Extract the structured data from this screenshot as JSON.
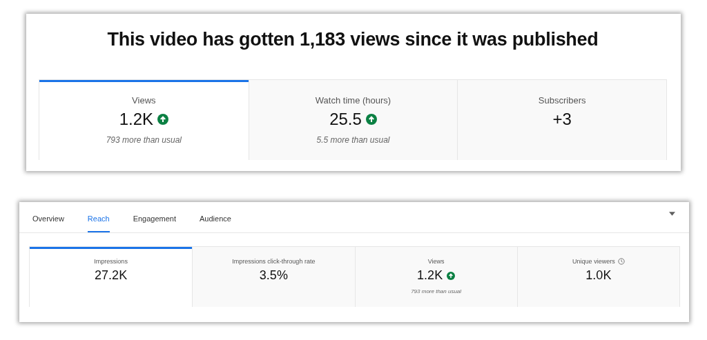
{
  "summary": {
    "heading": "This video has gotten 1,183 views since it was published",
    "metrics": [
      {
        "label": "Views",
        "value": "1.2K",
        "trending_up": true,
        "note": "793 more than usual",
        "selected": true
      },
      {
        "label": "Watch time (hours)",
        "value": "25.5",
        "trending_up": true,
        "note": "5.5 more than usual",
        "selected": false
      },
      {
        "label": "Subscribers",
        "value": "+3",
        "trending_up": false,
        "selected": false
      }
    ]
  },
  "reach": {
    "tabs": [
      {
        "label": "Overview",
        "selected": false
      },
      {
        "label": "Reach",
        "selected": true
      },
      {
        "label": "Engagement",
        "selected": false
      },
      {
        "label": "Audience",
        "selected": false
      }
    ],
    "metrics": [
      {
        "label": "Impressions",
        "value": "27.2K",
        "trending_up": false,
        "info": false,
        "selected": true
      },
      {
        "label": "Impressions click-through rate",
        "value": "3.5%",
        "trending_up": false,
        "info": false,
        "selected": false
      },
      {
        "label": "Views",
        "value": "1.2K",
        "trending_up": true,
        "info": false,
        "note": "793 more than usual",
        "selected": false
      },
      {
        "label": "Unique viewers",
        "value": "1.0K",
        "trending_up": false,
        "info": true,
        "selected": false
      }
    ]
  }
}
